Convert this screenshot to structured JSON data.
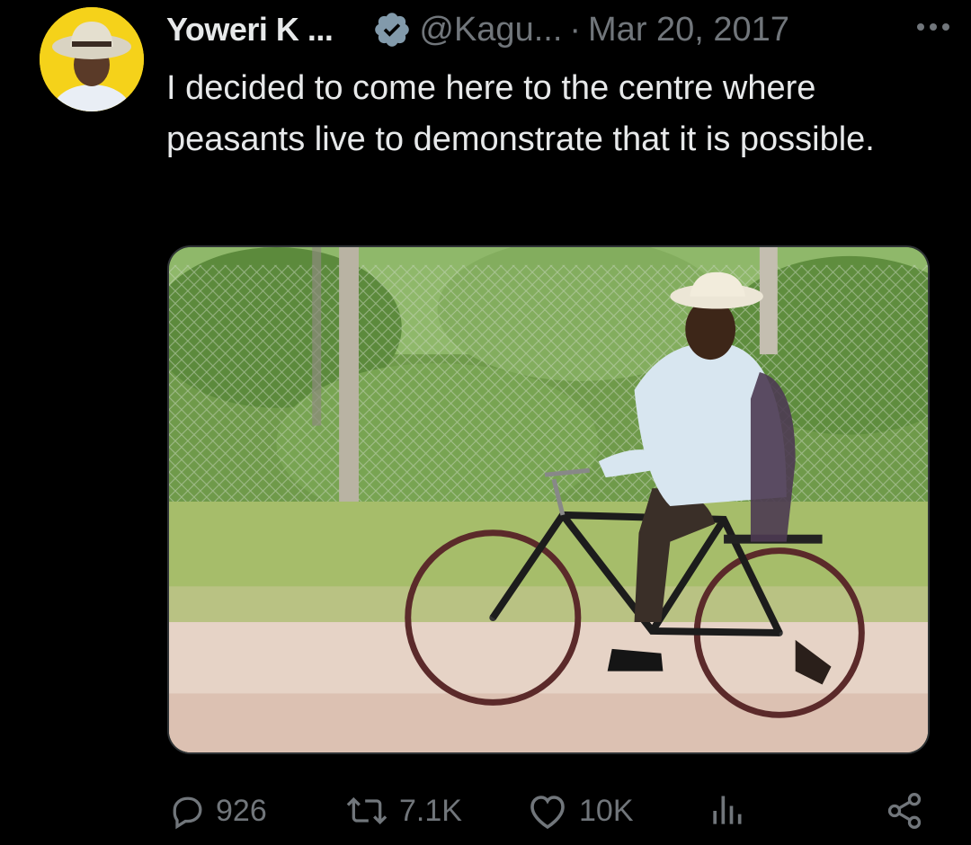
{
  "tweet": {
    "author_name": "Yoweri K ...",
    "handle": "@Kagu...",
    "separator": "·",
    "date": "Mar 20, 2017",
    "text": "I decided to come here to the centre where peasants live to demonstrate that it is possible."
  },
  "actions": {
    "replies": "926",
    "retweets": "7.1K",
    "likes": "10K"
  },
  "icons": {
    "verified": "verified-badge-icon",
    "more": "more-icon",
    "reply": "reply-icon",
    "retweet": "retweet-icon",
    "like": "heart-icon",
    "views": "views-icon",
    "share": "share-icon"
  },
  "colors": {
    "background": "#000000",
    "text": "#e7e9ea",
    "muted": "#71767b",
    "avatar_ring": "#f5d21a"
  }
}
